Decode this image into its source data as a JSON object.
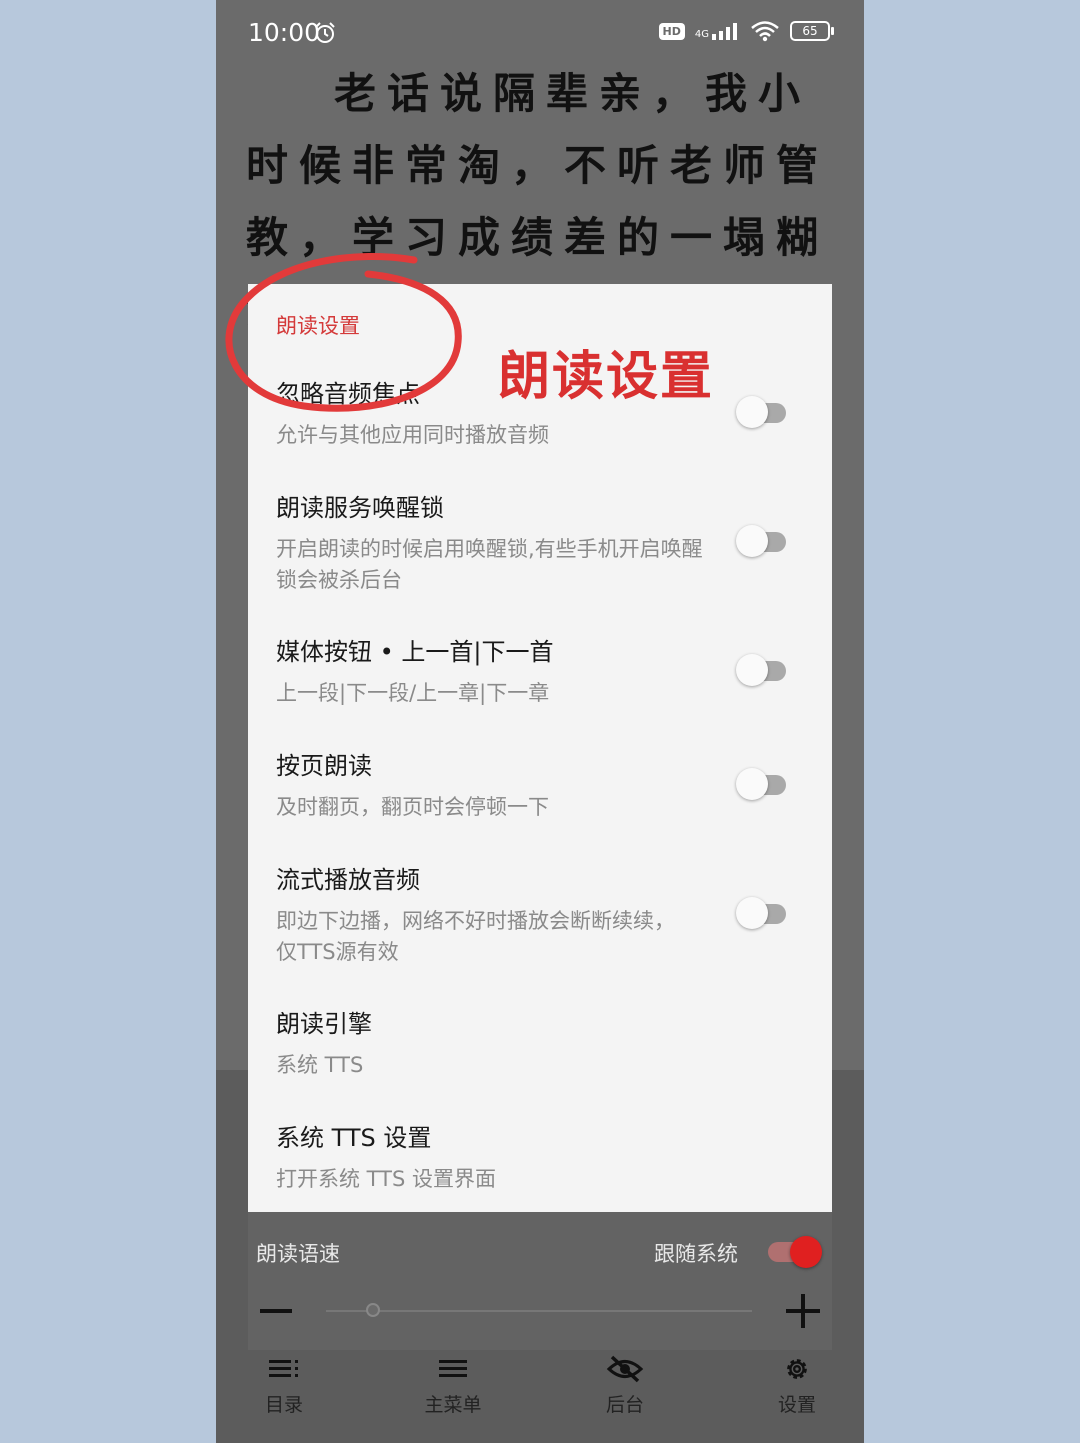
{
  "status_bar": {
    "time": "10:00",
    "hd": "HD",
    "network": "4G",
    "battery": "65"
  },
  "reader": {
    "text": "老话说隔辈亲，我小时候非常淘，不听老师管教，学习成绩差的一塌糊涂，常"
  },
  "dialog": {
    "title": "朗读设置",
    "settings": [
      {
        "title": "忽略音频焦点",
        "desc": "允许与其他应用同时播放音频",
        "toggle": "off"
      },
      {
        "title": "朗读服务唤醒锁",
        "desc": "开启朗读的时候启用唤醒锁,有些手机开启唤醒锁会被杀后台",
        "toggle": "off"
      },
      {
        "title": "媒体按钮 • 上一首|下一首",
        "desc": "上一段|下一段/上一章|下一章",
        "toggle": "off"
      },
      {
        "title": "按页朗读",
        "desc": "及时翻页，翻页时会停顿一下",
        "toggle": "off"
      },
      {
        "title": "流式播放音频",
        "desc": "即边下边播，网络不好时播放会断断续续，仅TTS源有效",
        "toggle": "off"
      },
      {
        "title": "朗读引擎",
        "desc": "系统 TTS"
      },
      {
        "title": "系统 TTS 设置",
        "desc": "打开系统 TTS 设置界面"
      }
    ]
  },
  "annotation": {
    "label": "朗读设置",
    "color": "#d93030"
  },
  "speed_panel": {
    "label": "朗读语速",
    "follow_system_label": "跟随系统",
    "follow_system": "on",
    "slider_value": 0.11
  },
  "bottom_nav": [
    {
      "label": "目录",
      "icon": "catalog-icon"
    },
    {
      "label": "主菜单",
      "icon": "menu-icon"
    },
    {
      "label": "后台",
      "icon": "eye-off-icon"
    },
    {
      "label": "设置",
      "icon": "gear-icon"
    }
  ],
  "colors": {
    "accent": "#d43a3a",
    "dialog_bg": "#f4f4f4",
    "overlay": "#6b6b6b"
  }
}
